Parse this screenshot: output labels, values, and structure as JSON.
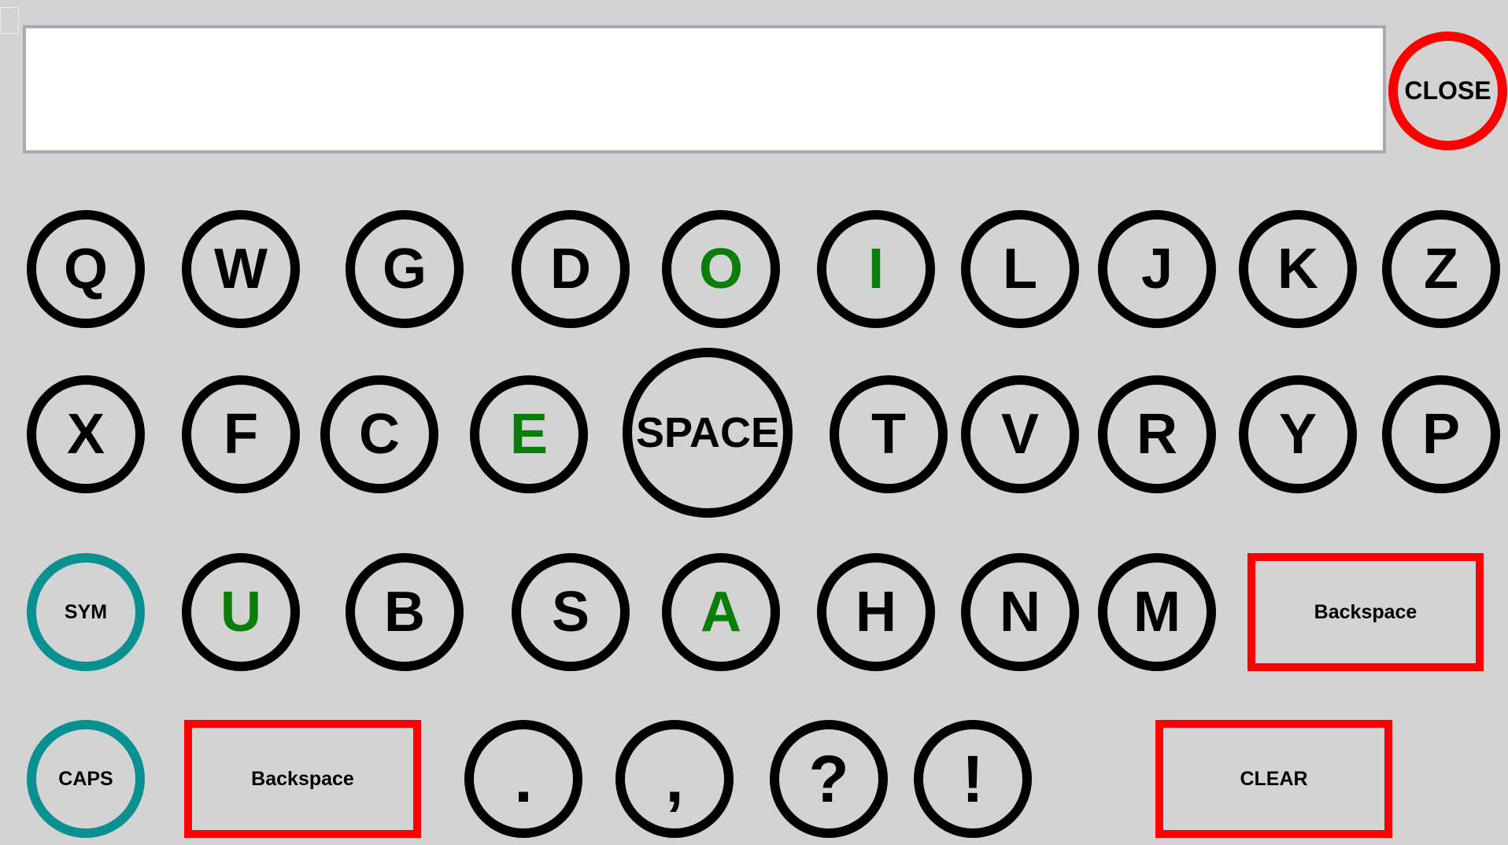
{
  "display": {
    "text": ""
  },
  "keys": {
    "close": "CLOSE",
    "q": "Q",
    "w": "W",
    "g": "G",
    "d": "D",
    "o": "O",
    "i": "I",
    "l": "L",
    "j": "J",
    "k": "K",
    "z": "Z",
    "x": "X",
    "f": "F",
    "c": "C",
    "e": "E",
    "space": "SPACE",
    "t": "T",
    "v": "V",
    "r": "R",
    "y": "Y",
    "p": "P",
    "sym": "SYM",
    "u": "U",
    "b": "B",
    "s": "S",
    "a": "A",
    "h": "H",
    "n": "N",
    "m": "M",
    "backspace_row3": "Backspace",
    "caps": "CAPS",
    "backspace_row4": "Backspace",
    "period": ".",
    "comma": ",",
    "question": "?",
    "exclaim": "!",
    "clear": "CLEAR"
  },
  "colors": {
    "background": "#d3d3d3",
    "key_border": "#000000",
    "vowel_text": "#0a7d0a",
    "modifier_border": "#099090",
    "action_border": "#ff0000"
  }
}
